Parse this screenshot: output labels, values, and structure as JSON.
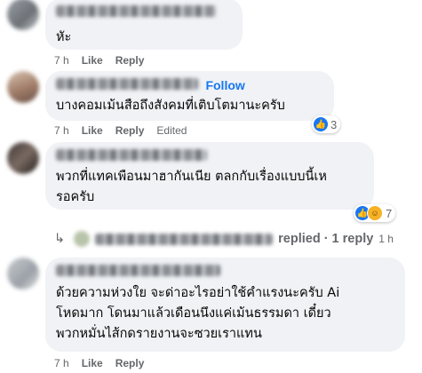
{
  "comments": [
    {
      "text": "หัะ",
      "time": "7 h",
      "like": "Like",
      "reply": "Reply"
    },
    {
      "follow": "Follow",
      "text": "บางคอมเม้นสือถึงสังคมที่เติบโตมานะครับ",
      "time": "7 h",
      "like": "Like",
      "reply": "Reply",
      "edited": "Edited",
      "reaction_count": "3"
    },
    {
      "text": "พวกที่แทคเพือนมาฮากันเนีย ตลกกับเรื่องแบบนี้เห\nรอครับ",
      "time": "7 h",
      "like": "Like",
      "reply": "Reply",
      "reaction_count": "7"
    },
    {
      "text": "ด้วยความห่วงใย จะด่าอะไรอย่าใช้คำแรงนะครับ Ai\nโหดมาก โดนมาแล้วเดือนนึงแค่เม้นธรรมดา เดี๋ยว\nพวกหมั่นไส้กดรายงานจะซวยเราแทน",
      "time": "7 h",
      "like": "Like",
      "reply": "Reply"
    }
  ],
  "reply_summary": {
    "arrow": "↳",
    "replied": "replied",
    "sep": "·",
    "count": "1 reply",
    "time": "1 h"
  },
  "colors": {
    "link": "#1877f2",
    "bubble": "#f0f2f5",
    "meta": "#65676b"
  }
}
